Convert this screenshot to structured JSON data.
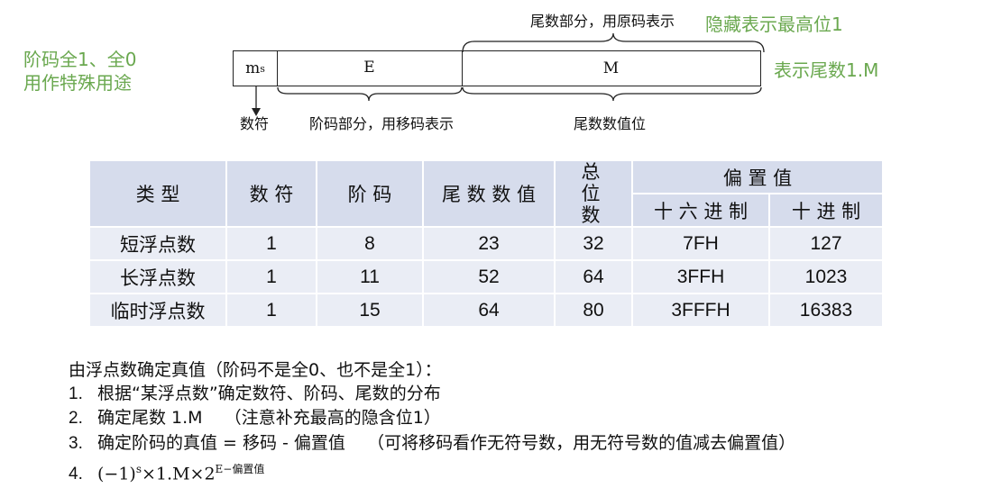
{
  "diagram": {
    "left_note": [
      "阶码全1、全0",
      "用作特殊用途"
    ],
    "right_top_note": "隐藏表示最高位1",
    "right_note": "表示尾数1.M",
    "mantissa_caption": "尾数部分，用原码表示",
    "sign_field": "m",
    "sign_sub": "s",
    "exp_field": "E",
    "mant_field": "M",
    "sign_caption": "数符",
    "exp_caption": "阶码部分，用移码表示",
    "mant_value_caption": "尾数数值位"
  },
  "table": {
    "headers": [
      "类 型",
      "数 符",
      "阶 码",
      "尾 数 数 值",
      "总 位 数",
      "偏 置 值"
    ],
    "subheaders": [
      "十 六 进 制",
      "十 进 制"
    ],
    "rows": [
      [
        "短浮点数",
        "1",
        "8",
        "23",
        "32",
        "7FH",
        "127"
      ],
      [
        "长浮点数",
        "1",
        "11",
        "52",
        "64",
        "3FFH",
        "1023"
      ],
      [
        "临时浮点数",
        "1",
        "15",
        "64",
        "80",
        "3FFFH",
        "16383"
      ]
    ]
  },
  "steps": {
    "intro": "由浮点数确定真值（阶码不是全0、也不是全1）：",
    "items": [
      {
        "num": "1.",
        "text": "根据“某浮点数”确定数符、阶码、尾数的分布"
      },
      {
        "num": "2.",
        "text": "确定尾数 1.M    （注意补充最高的隐含位1）"
      },
      {
        "num": "3.",
        "text": "确定阶码的真值 = 移码 - 偏置值    （可将移码看作无符号数，用无符号数的值减去偏置值）"
      }
    ],
    "formula_num": "4.",
    "formula_main": "(−1)",
    "formula_s": "s",
    "formula_mid": "×1.M×2",
    "formula_exp": "E−偏置值"
  }
}
